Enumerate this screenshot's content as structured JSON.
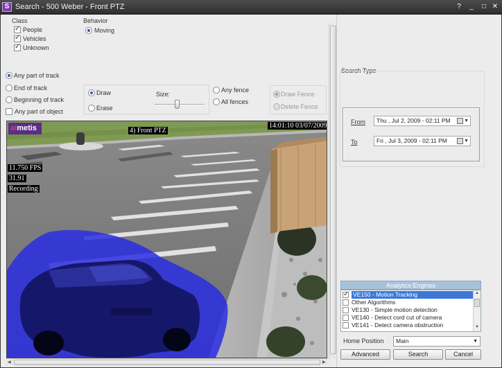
{
  "window": {
    "title": "Search - 500 Weber - Front PTZ",
    "app_icon_letter": "S"
  },
  "titlebar_buttons": {
    "help": "?",
    "minimize": "_",
    "maximize": "□",
    "close": "✕"
  },
  "class_section": {
    "label": "Class",
    "items": [
      {
        "label": "People",
        "checked": true
      },
      {
        "label": "Vehicles",
        "checked": true
      },
      {
        "label": "Unknown",
        "checked": true
      }
    ]
  },
  "behavior_section": {
    "label": "Behavior",
    "option": "Moving",
    "selected": true
  },
  "track_options": {
    "any_part": "Any part of track",
    "end": "End of track",
    "beginning": "Beginning of track",
    "any_part_object": "Any part of object",
    "selected": "Any part of track"
  },
  "draw_group": {
    "draw": "Draw",
    "erase": "Erase",
    "size_label": "Size:",
    "size_value": 0.45
  },
  "fence_group": {
    "any_fence": "Any fence",
    "all_fences": "All fences"
  },
  "fence_actions": {
    "draw_fence": "Draw Fence",
    "delete_fence": "Delete Fence"
  },
  "video": {
    "logo_prefix": "ai",
    "logo_rest": "metis",
    "camera_label": "4) Front PTZ",
    "timestamp": "14:01:10 03/07/2009",
    "fps": "11.750 FPS",
    "value": "31.91",
    "status": "Recording"
  },
  "search_type": {
    "label": "Search Type",
    "from_label": "From",
    "from_value": "Thu ,  Jul    2, 2009 - 02:11  PM",
    "to_label": "To",
    "to_value": "Fri ,  Jul    3, 2009 - 02:11  PM"
  },
  "analytics": {
    "header": "Analytics Engines",
    "items": [
      {
        "label": "VE150 - Motion Tracking",
        "checked": true,
        "selected": true
      },
      {
        "label": "Other Algorithms",
        "checked": false,
        "selected": false
      },
      {
        "label": "VE130 - Simple motion detection",
        "checked": false,
        "selected": false
      },
      {
        "label": "VE140 - Detect cord cut of camera",
        "checked": false,
        "selected": false
      },
      {
        "label": "VE141 - Detect camera obstruction",
        "checked": false,
        "selected": false
      }
    ]
  },
  "home_position": {
    "label": "Home Position",
    "value": "Main"
  },
  "buttons": {
    "advanced": "Advanced",
    "search": "Search",
    "cancel": "Cancel"
  },
  "colors": {
    "selection": "#3a78d8",
    "mask": "#2a2ee0",
    "header": "#a9c2dc"
  }
}
